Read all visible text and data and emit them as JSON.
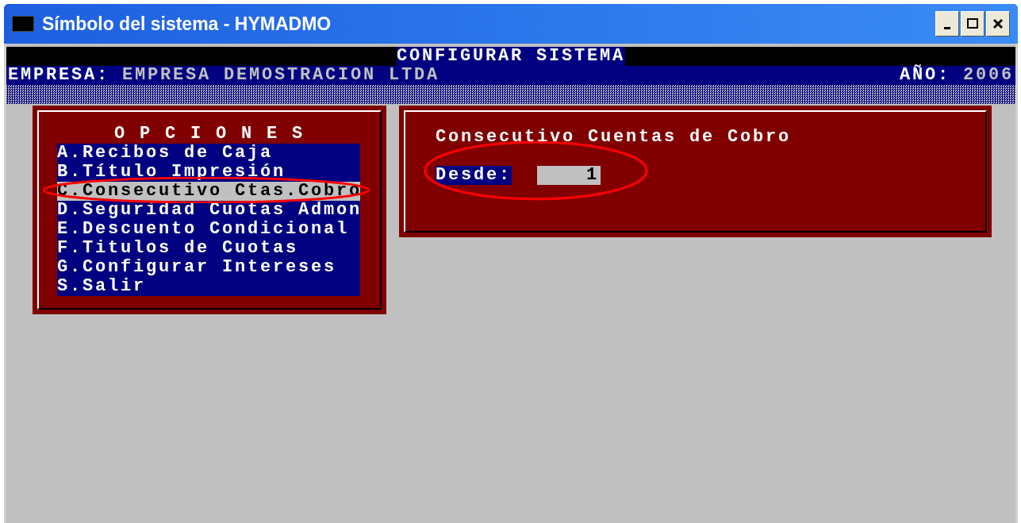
{
  "window": {
    "title": "Símbolo del sistema - HYMADMO"
  },
  "header": {
    "title": "CONFIGURAR SISTEMA",
    "company_label": "EMPRESA:",
    "company": "EMPRESA DEMOSTRACION LTDA",
    "year_label": "AÑO:",
    "year": "2006"
  },
  "menu": {
    "title": "O P C I O N E S",
    "items": [
      {
        "label": "A.Recibos de Caja",
        "selected": false
      },
      {
        "label": "B.Título Impresión",
        "selected": false
      },
      {
        "label": "C.Consecutivo Ctas.Cobro",
        "selected": true
      },
      {
        "label": "D.Seguridad Cuotas Admon",
        "selected": false
      },
      {
        "label": "E.Descuento Condicional",
        "selected": false
      },
      {
        "label": "F.Titulos de Cuotas",
        "selected": false
      },
      {
        "label": "G.Configurar Intereses",
        "selected": false
      },
      {
        "label": "S.Salir",
        "selected": false
      }
    ]
  },
  "form": {
    "title": "Consecutivo Cuentas de Cobro",
    "fields": [
      {
        "label": "Desde:",
        "value": "1"
      }
    ]
  }
}
